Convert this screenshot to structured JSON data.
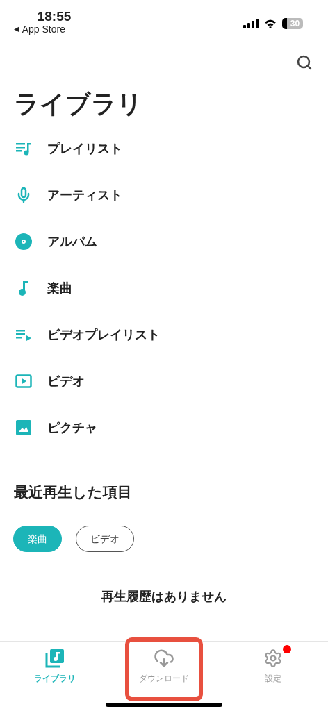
{
  "status_bar": {
    "time": "18:55",
    "back_arrow": "◀",
    "back_label": "App Store",
    "battery": "30"
  },
  "title": "ライブラリ",
  "library_items": [
    {
      "kind": "playlist",
      "label": "プレイリスト"
    },
    {
      "kind": "artist",
      "label": "アーティスト"
    },
    {
      "kind": "album",
      "label": "アルバム"
    },
    {
      "kind": "song",
      "label": "楽曲"
    },
    {
      "kind": "video_playlist",
      "label": "ビデオプレイリスト"
    },
    {
      "kind": "video",
      "label": "ビデオ"
    },
    {
      "kind": "picture",
      "label": "ピクチャ"
    }
  ],
  "recent": {
    "heading": "最近再生した項目",
    "filters": [
      {
        "label": "楽曲",
        "selected": true
      },
      {
        "label": "ビデオ",
        "selected": false
      }
    ],
    "empty_message": "再生履歴はありません"
  },
  "tab_bar": [
    {
      "kind": "library",
      "label": "ライブラリ",
      "selected": true,
      "highlighted": false,
      "badge": false
    },
    {
      "kind": "download",
      "label": "ダウンロード",
      "selected": false,
      "highlighted": true,
      "badge": false
    },
    {
      "kind": "settings",
      "label": "設定",
      "selected": false,
      "highlighted": false,
      "badge": true
    }
  ]
}
